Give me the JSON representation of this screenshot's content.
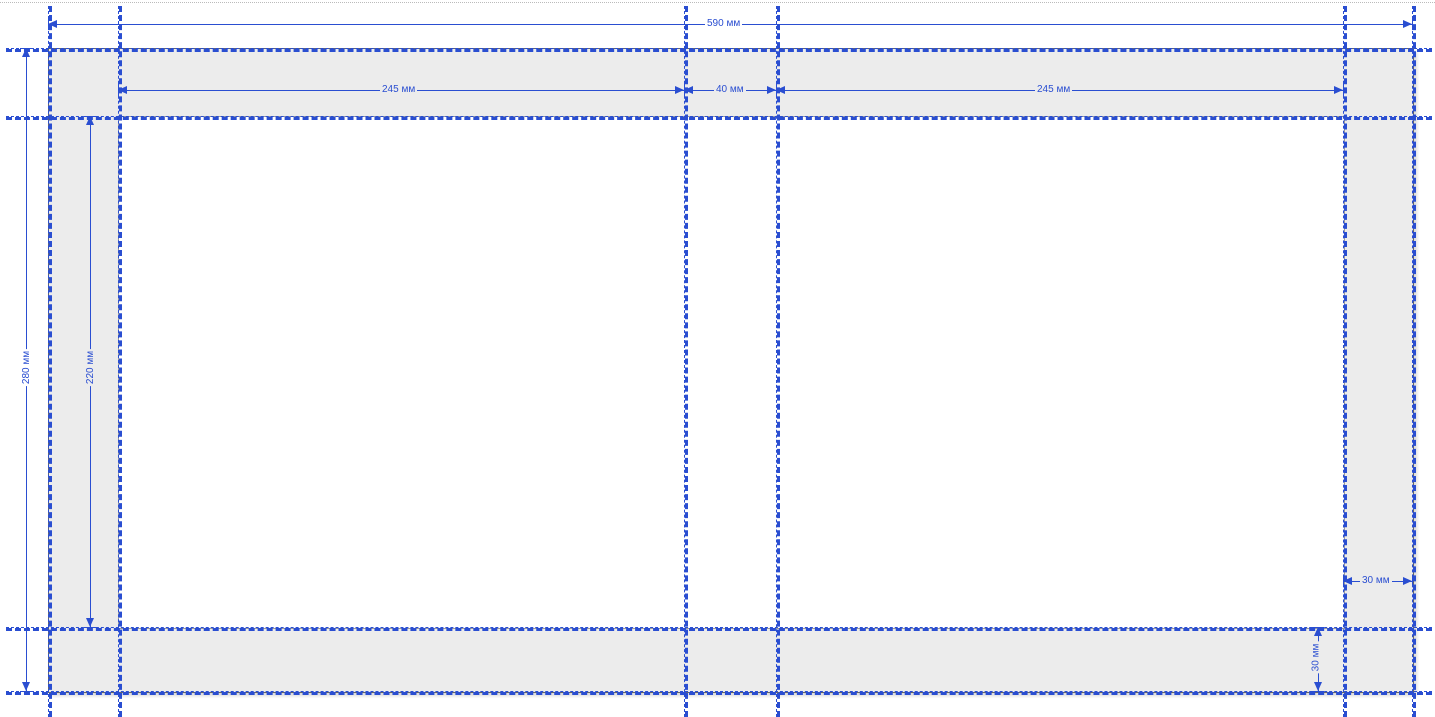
{
  "dimensions": {
    "total_width": "590 мм",
    "panel_left": "245 мм",
    "spine": "40 мм",
    "panel_right": "245 мм",
    "total_height": "280 мм",
    "inner_height": "220 мм",
    "margin_right": "30 мм",
    "margin_bottom": "30 мм"
  },
  "units": "мм",
  "colors": {
    "guide": "#2a4ed1",
    "outer_fill": "#ececec",
    "inner_fill": "#ffffff"
  }
}
